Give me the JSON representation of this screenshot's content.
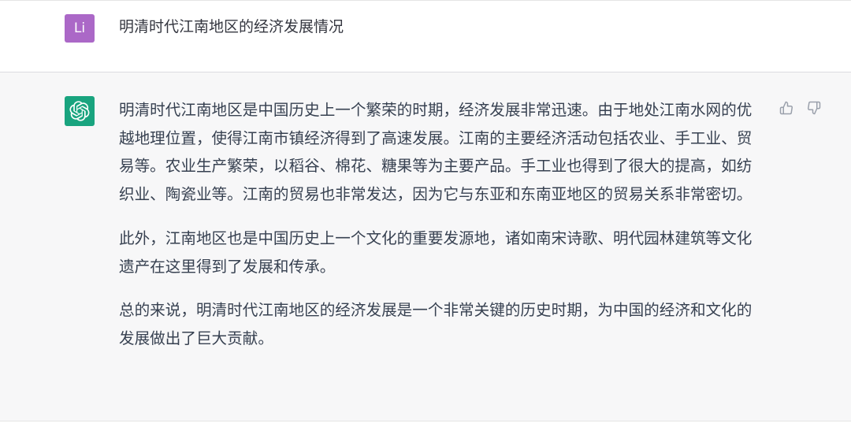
{
  "user": {
    "avatar_text": "Li",
    "message": "明清时代江南地区的经济发展情况"
  },
  "assistant": {
    "avatar_icon": "openai-logo-icon",
    "paragraphs": [
      "明清时代江南地区是中国历史上一个繁荣的时期，经济发展非常迅速。由于地处江南水网的优越地理位置，使得江南市镇经济得到了高速发展。江南的主要经济活动包括农业、手工业、贸易等。农业生产繁荣，以稻谷、棉花、糖果等为主要产品。手工业也得到了很大的提高，如纺织业、陶瓷业等。江南的贸易也非常发达，因为它与东亚和东南亚地区的贸易关系非常密切。",
      "此外，江南地区也是中国历史上一个文化的重要发源地，诸如南宋诗歌、明代园林建筑等文化遗产在这里得到了发展和传承。",
      "总的来说，明清时代江南地区的经济发展是一个非常关键的历史时期，为中国的经济和文化的发展做出了巨大贡献。"
    ],
    "feedback": {
      "thumbs_up_icon": "thumbs-up-icon",
      "thumbs_down_icon": "thumbs-down-icon"
    }
  }
}
